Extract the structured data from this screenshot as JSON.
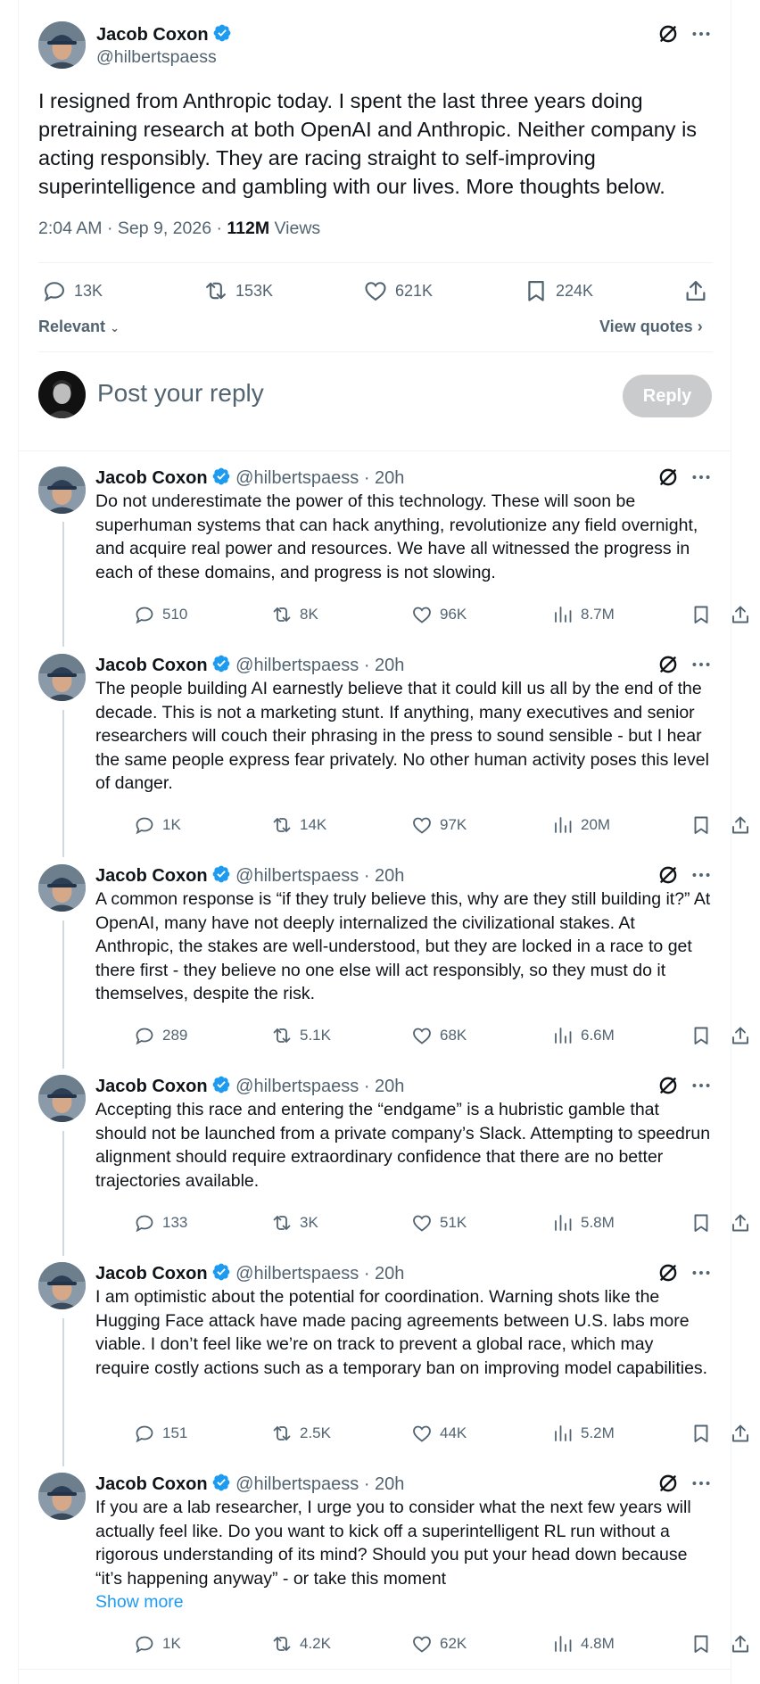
{
  "main_tweet": {
    "author": "Jacob Coxon",
    "handle": "@hilbertspaess",
    "text": "I resigned from Anthropic today. I spent the last three years doing pretraining research at both OpenAI and Anthropic. Neither company is acting responsibly. They are racing straight to self-improving superintelligence and gambling with our lives. More thoughts below.",
    "timestamp": "2:04 AM · Sep 9, 2026 · ",
    "views_count": "112M",
    "views_label": " Views",
    "replies": "13K",
    "reposts": "153K",
    "likes": "621K",
    "bookmarks": "224K"
  },
  "sort": {
    "relevant_label": "Relevant",
    "view_quotes_label": "View quotes"
  },
  "composer": {
    "placeholder": "Post your reply",
    "reply_button": "Reply"
  },
  "replies": [
    {
      "author": "Jacob Coxon",
      "handle": "@hilbertspaess · 20h",
      "text": "Do not underestimate the power of this technology. These will soon be superhuman systems that can hack anything, revolutionize any field overnight, and acquire real power and resources. We have all witnessed the progress in each of these domains, and progress is not slowing.",
      "replies": "510",
      "reposts": "8K",
      "likes": "96K",
      "views": "8.7M"
    },
    {
      "author": "Jacob Coxon",
      "handle": "@hilbertspaess · 20h",
      "text": "The people building AI earnestly believe that it could kill us all by the end of the decade. This is not a marketing stunt. If anything, many executives and senior researchers will couch their phrasing in the press to sound sensible - but I hear the same people express fear privately. No other human activity poses this level of danger.",
      "replies": "1K",
      "reposts": "14K",
      "likes": "97K",
      "views": "20M"
    },
    {
      "author": "Jacob Coxon",
      "handle": "@hilbertspaess · 20h",
      "text": "A common response is “if they truly believe this, why are they still building it?” At OpenAI, many have not deeply internalized the civilizational stakes. At Anthropic, the stakes are well-understood, but they are locked in a race to get there first - they believe no one else will act responsibly, so they must do it themselves, despite the risk.",
      "replies": "289",
      "reposts": "5.1K",
      "likes": "68K",
      "views": "6.6M"
    },
    {
      "author": "Jacob Coxon",
      "handle": "@hilbertspaess · 20h",
      "text": "Accepting this race and entering the “endgame” is a hubristic gamble that should not be launched from a private company’s Slack. Attempting to speedrun alignment should require extraordinary confidence that there are no better trajectories available.",
      "replies": "133",
      "reposts": "3K",
      "likes": "51K",
      "views": "5.8M"
    },
    {
      "author": "Jacob Coxon",
      "handle": "@hilbertspaess · 20h",
      "text": "I am optimistic about the potential for coordination. Warning shots like the Hugging Face attack have made pacing agreements between U.S. labs more viable. I don’t feel like we’re on track to prevent a global race, which may require costly actions such as a temporary ban on improving model capabilities.",
      "replies": "151",
      "reposts": "2.5K",
      "likes": "44K",
      "views": "5.2M"
    },
    {
      "author": "Jacob Coxon",
      "handle": "@hilbertspaess · 20h",
      "text": "If you are a lab researcher, I urge you to consider what the next few years will actually feel like. Do you want to kick off a superintelligent RL run without a rigorous understanding of its mind? Should you put your head down because “it’s happening anyway” - or take this moment",
      "show_more": "Show more",
      "replies": "1K",
      "reposts": "4.2K",
      "likes": "62K",
      "views": "4.8M"
    }
  ],
  "colors": {
    "accent": "#1d9bf0",
    "verified": "#1d9bf0",
    "muted": "#536471"
  }
}
